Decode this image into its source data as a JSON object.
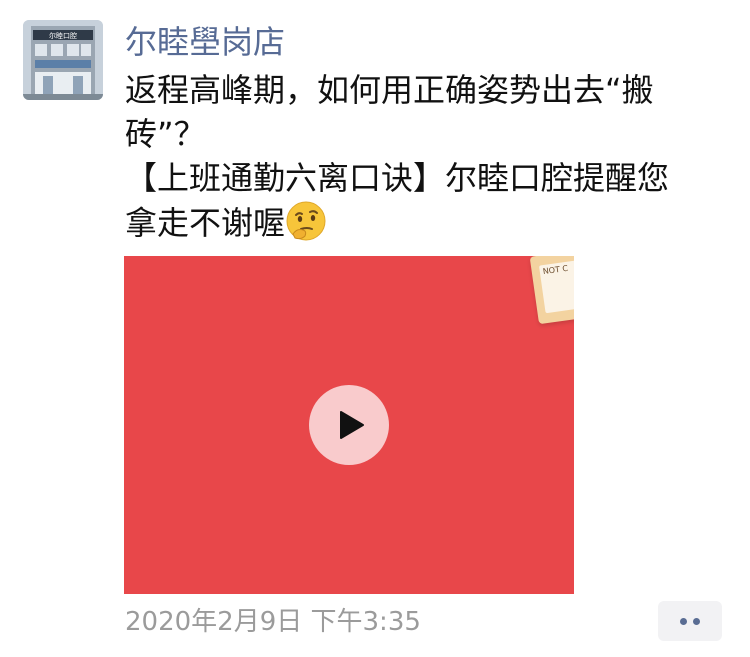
{
  "post": {
    "username": "尔睦壆岗店",
    "text_lines": [
      "返程高峰期，如何用正确姿势出去“搬",
      "砖”？",
      "【上班通勤六离口诀】尔睦口腔提醒您",
      "拿走不谢喔"
    ],
    "emoji": "thinking-face-emoji",
    "timestamp": "2020年2月9日 下午3:35"
  },
  "avatar": {
    "sign_text": "尔睦口腔"
  },
  "video": {
    "background_color": "#e8474a",
    "card_text": "NOT C"
  },
  "colors": {
    "username": "#576b95",
    "timestamp": "#9b9b9b",
    "more_dots": "#5a6d93"
  }
}
